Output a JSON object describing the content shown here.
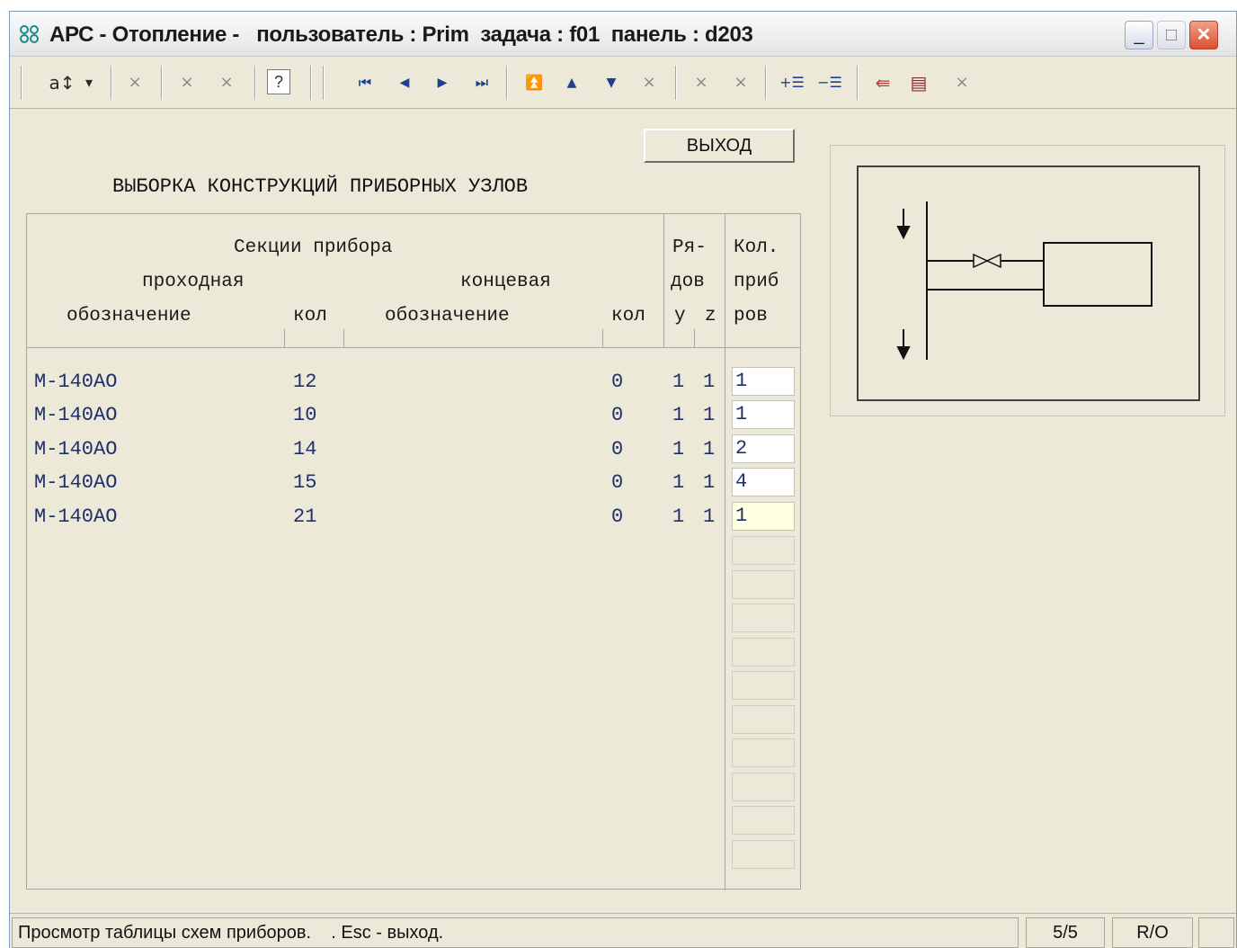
{
  "window": {
    "title": "АРС - Отопление -   пользователь : Prim  задача : f01  панель : d203",
    "minimize_glyph": "_",
    "maximize_glyph": "□",
    "close_glyph": "✕"
  },
  "toolbar": {
    "sort_label": "a↕",
    "sort_dropdown": "▾",
    "disabled_glyph": "×",
    "help_label": "?",
    "first_glyph": "⏮",
    "prev_glyph": "◀",
    "next_glyph": "▶",
    "last_glyph": "⏭",
    "top_glyph": "⏫",
    "up_glyph": "▲",
    "down_glyph": "▼",
    "insert_row_glyph": "+☰",
    "delete_row_glyph": "−☰",
    "import_glyph": "⇚",
    "save_glyph": "▤"
  },
  "form": {
    "exit_button": "ВЫХОД",
    "heading": "ВЫБОРКА КОНСТРУКЦИЙ ПРИБОРНЫХ УЗЛОВ"
  },
  "table": {
    "header": {
      "sections": "Секции прибора",
      "pass": "проходная",
      "end": "концевая",
      "designation1": "обозначение",
      "qty1": "кол",
      "designation2": "обозначение",
      "qty2": "кол",
      "rows_line1": "Ря-",
      "rows_line2": "дов",
      "rows_y": "y",
      "rows_z": "z",
      "count_line1": "Кол.",
      "count_line2": "приб",
      "count_line3": "ров"
    },
    "rows": [
      {
        "designation": "М-140АО",
        "qty": "12",
        "end_qty": "0",
        "y": "1",
        "z": "1",
        "count": "1"
      },
      {
        "designation": "М-140АО",
        "qty": "10",
        "end_qty": "0",
        "y": "1",
        "z": "1",
        "count": "1"
      },
      {
        "designation": "М-140АО",
        "qty": "14",
        "end_qty": "0",
        "y": "1",
        "z": "1",
        "count": "2"
      },
      {
        "designation": "М-140АО",
        "qty": "15",
        "end_qty": "0",
        "y": "1",
        "z": "1",
        "count": "4"
      },
      {
        "designation": "М-140АО",
        "qty": "21",
        "end_qty": "0",
        "y": "1",
        "z": "1",
        "count": "1"
      }
    ]
  },
  "statusbar": {
    "message": "Просмотр таблицы схем приборов.    . Esc - выход.",
    "record": "5/5",
    "mode": "R/O"
  }
}
